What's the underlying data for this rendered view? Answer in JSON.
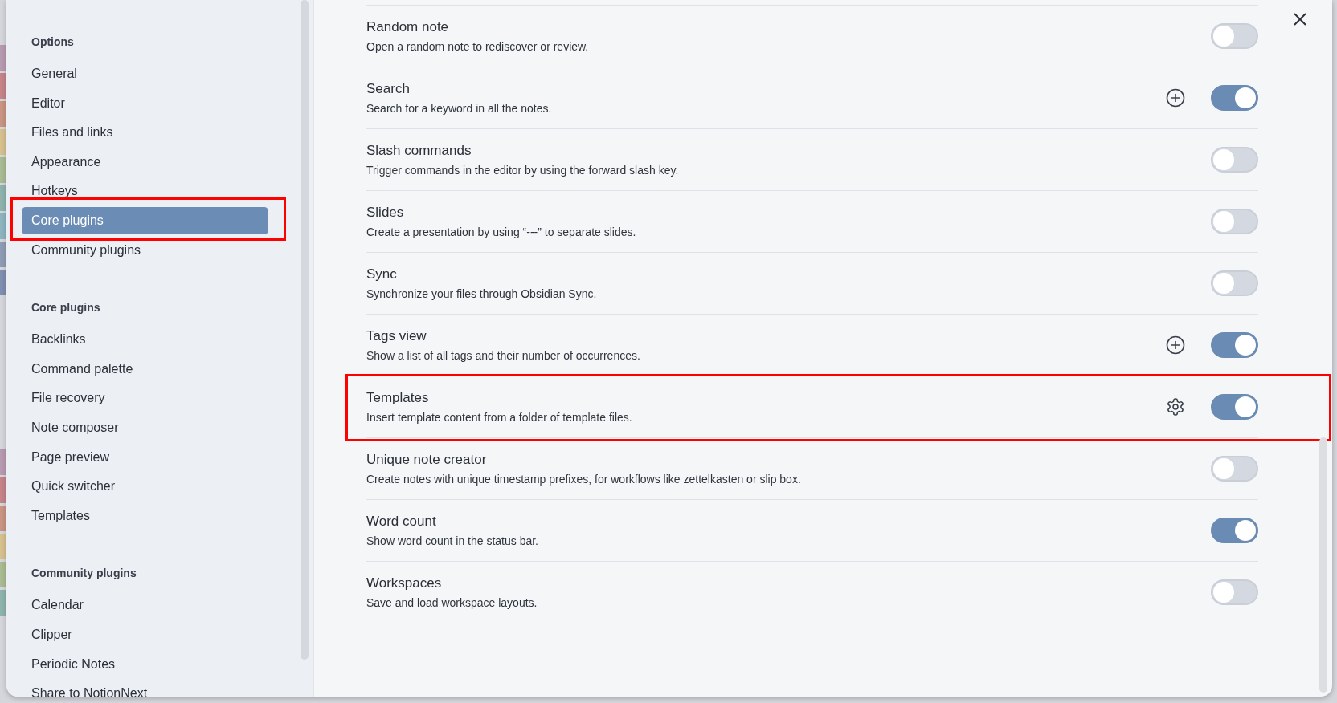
{
  "sidebar": {
    "sections": [
      {
        "heading": "Options",
        "items": [
          {
            "label": "General",
            "selected": false,
            "highlighted": false
          },
          {
            "label": "Editor",
            "selected": false,
            "highlighted": false
          },
          {
            "label": "Files and links",
            "selected": false,
            "highlighted": false
          },
          {
            "label": "Appearance",
            "selected": false,
            "highlighted": false
          },
          {
            "label": "Hotkeys",
            "selected": false,
            "highlighted": false
          },
          {
            "label": "Core plugins",
            "selected": true,
            "highlighted": true
          },
          {
            "label": "Community plugins",
            "selected": false,
            "highlighted": false
          }
        ]
      },
      {
        "heading": "Core plugins",
        "items": [
          {
            "label": "Backlinks",
            "selected": false,
            "highlighted": false
          },
          {
            "label": "Command palette",
            "selected": false,
            "highlighted": false
          },
          {
            "label": "File recovery",
            "selected": false,
            "highlighted": false
          },
          {
            "label": "Note composer",
            "selected": false,
            "highlighted": false
          },
          {
            "label": "Page preview",
            "selected": false,
            "highlighted": false
          },
          {
            "label": "Quick switcher",
            "selected": false,
            "highlighted": false
          },
          {
            "label": "Templates",
            "selected": false,
            "highlighted": false
          }
        ]
      },
      {
        "heading": "Community plugins",
        "items": [
          {
            "label": "Calendar",
            "selected": false,
            "highlighted": false
          },
          {
            "label": "Clipper",
            "selected": false,
            "highlighted": false
          },
          {
            "label": "Periodic Notes",
            "selected": false,
            "highlighted": false
          },
          {
            "label": "Share to NotionNext",
            "selected": false,
            "highlighted": false
          }
        ]
      }
    ]
  },
  "plugins": [
    {
      "title": "Random note",
      "description": "Open a random note to rediscover or review.",
      "enabled": false,
      "kind": "plain",
      "highlighted": false
    },
    {
      "title": "Search",
      "description": "Search for a keyword in all the notes.",
      "enabled": true,
      "kind": "add",
      "highlighted": false
    },
    {
      "title": "Slash commands",
      "description": "Trigger commands in the editor by using the forward slash key.",
      "enabled": false,
      "kind": "plain",
      "highlighted": false
    },
    {
      "title": "Slides",
      "description": "Create a presentation by using “---” to separate slides.",
      "enabled": false,
      "kind": "plain",
      "highlighted": false
    },
    {
      "title": "Sync",
      "description": "Synchronize your files through Obsidian Sync.",
      "enabled": false,
      "kind": "plain",
      "highlighted": false
    },
    {
      "title": "Tags view",
      "description": "Show a list of all tags and their number of occurrences.",
      "enabled": true,
      "kind": "add",
      "highlighted": false
    },
    {
      "title": "Templates",
      "description": "Insert template content from a folder of template files.",
      "enabled": true,
      "kind": "settings",
      "highlighted": true
    },
    {
      "title": "Unique note creator",
      "description": "Create notes with unique timestamp prefixes, for workflows like zettelkasten or slip box.",
      "enabled": false,
      "kind": "plain",
      "highlighted": false
    },
    {
      "title": "Word count",
      "description": "Show word count in the status bar.",
      "enabled": true,
      "kind": "plain",
      "highlighted": false
    },
    {
      "title": "Workspaces",
      "description": "Save and load workspace layouts.",
      "enabled": false,
      "kind": "plain",
      "highlighted": false
    }
  ]
}
